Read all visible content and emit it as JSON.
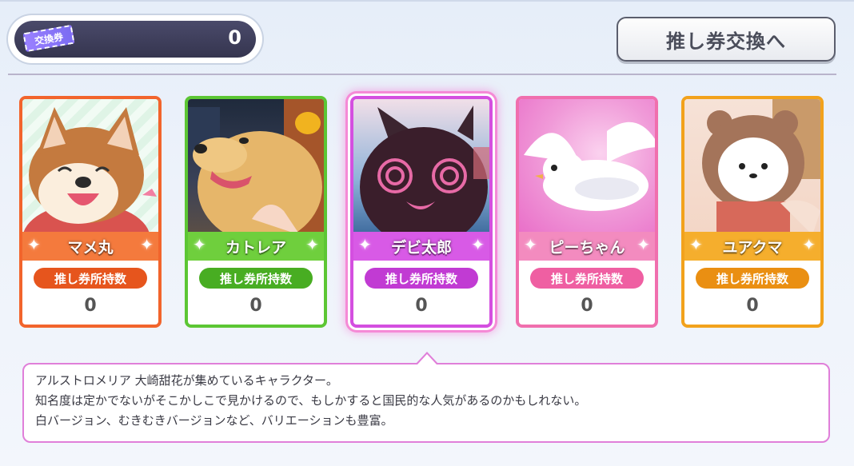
{
  "ticket": {
    "badge": "交換券",
    "count": "0"
  },
  "exchange_button": {
    "label": "推し券交換へ"
  },
  "cards": [
    {
      "name": "マメ丸",
      "pill": "推し券所持数",
      "count": "0",
      "theme": "#f2642c",
      "pill_color": "#e6551d",
      "band_color": "#f47a3d"
    },
    {
      "name": "カトレア",
      "pill": "推し券所持数",
      "count": "0",
      "theme": "#5cc634",
      "pill_color": "#48ad22",
      "band_color": "#6fcf3d"
    },
    {
      "name": "デビ太郎",
      "pill": "推し券所持数",
      "count": "0",
      "theme": "#d44fe0",
      "pill_color": "#c13bd3",
      "band_color": "#d85ae6",
      "selected": true
    },
    {
      "name": "ピーちゃん",
      "pill": "推し券所持数",
      "count": "0",
      "theme": "#f06fae",
      "pill_color": "#ef5fa2",
      "band_color": "#f38bbf"
    },
    {
      "name": "ユアクマ",
      "pill": "推し券所持数",
      "count": "0",
      "theme": "#f2a21c",
      "pill_color": "#ea8f12",
      "band_color": "#f5ae2d"
    }
  ],
  "description": {
    "line1": "アルストロメリア 大崎甜花が集めているキャラクター。",
    "line2": "知名度は定かでないがそこかしこで見かけるので、もしかすると国民的な人気があるのかもしれない。",
    "line3": "白バージョン、むきむきバージョンなど、バリエーションも豊富。"
  }
}
